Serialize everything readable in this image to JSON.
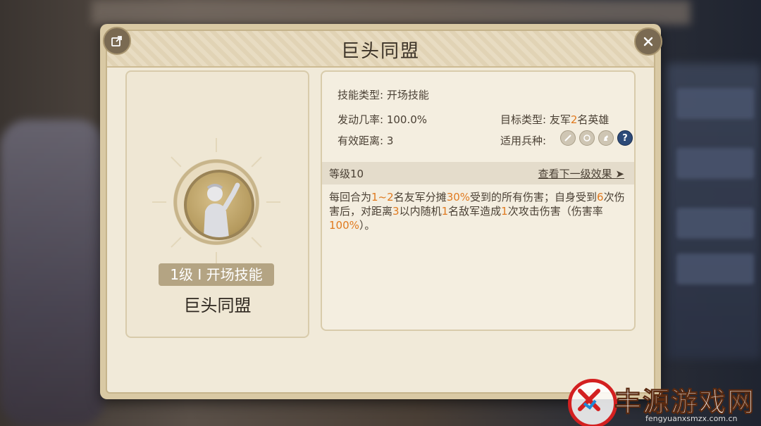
{
  "dialog": {
    "title": "巨头同盟"
  },
  "skill_card": {
    "tag": "1级 I 开场技能",
    "name": "巨头同盟"
  },
  "info": {
    "skill_type": "技能类型: 开场技能",
    "trigger_rate": "发动几率: 100.0%",
    "target_type_label": "目标类型: ",
    "target_type_prefix": "友军",
    "target_type_num": "2",
    "target_type_suffix": "名英雄",
    "range": "有效距离: 3",
    "applicable_units": "适用兵种:",
    "unit_icons": [
      "sword-icon",
      "shield-icon",
      "horse-icon",
      "question-icon"
    ]
  },
  "level": {
    "label": "等级10",
    "next_link": "查看下一级效果 ➤"
  },
  "description": {
    "p1": "每回合为",
    "h1": "1~2",
    "p2": "名友军分摊",
    "h2": "30%",
    "p3": "受到的所有伤害；自身受到",
    "h3": "6",
    "p4": "次伤害后，对距离",
    "h4": "3",
    "p5": "以内随机",
    "h5": "1",
    "p6": "名敌军造成",
    "h6": "1",
    "p7": "次攻击伤害（伤害率",
    "h7": "100%",
    "p8": "）。"
  },
  "watermark": {
    "brand": "丰源游戏网",
    "url": "fengyuanxsmzx.com.cn"
  },
  "colors": {
    "highlight": "#e07a1f",
    "active_unit": "#2d4a78"
  }
}
